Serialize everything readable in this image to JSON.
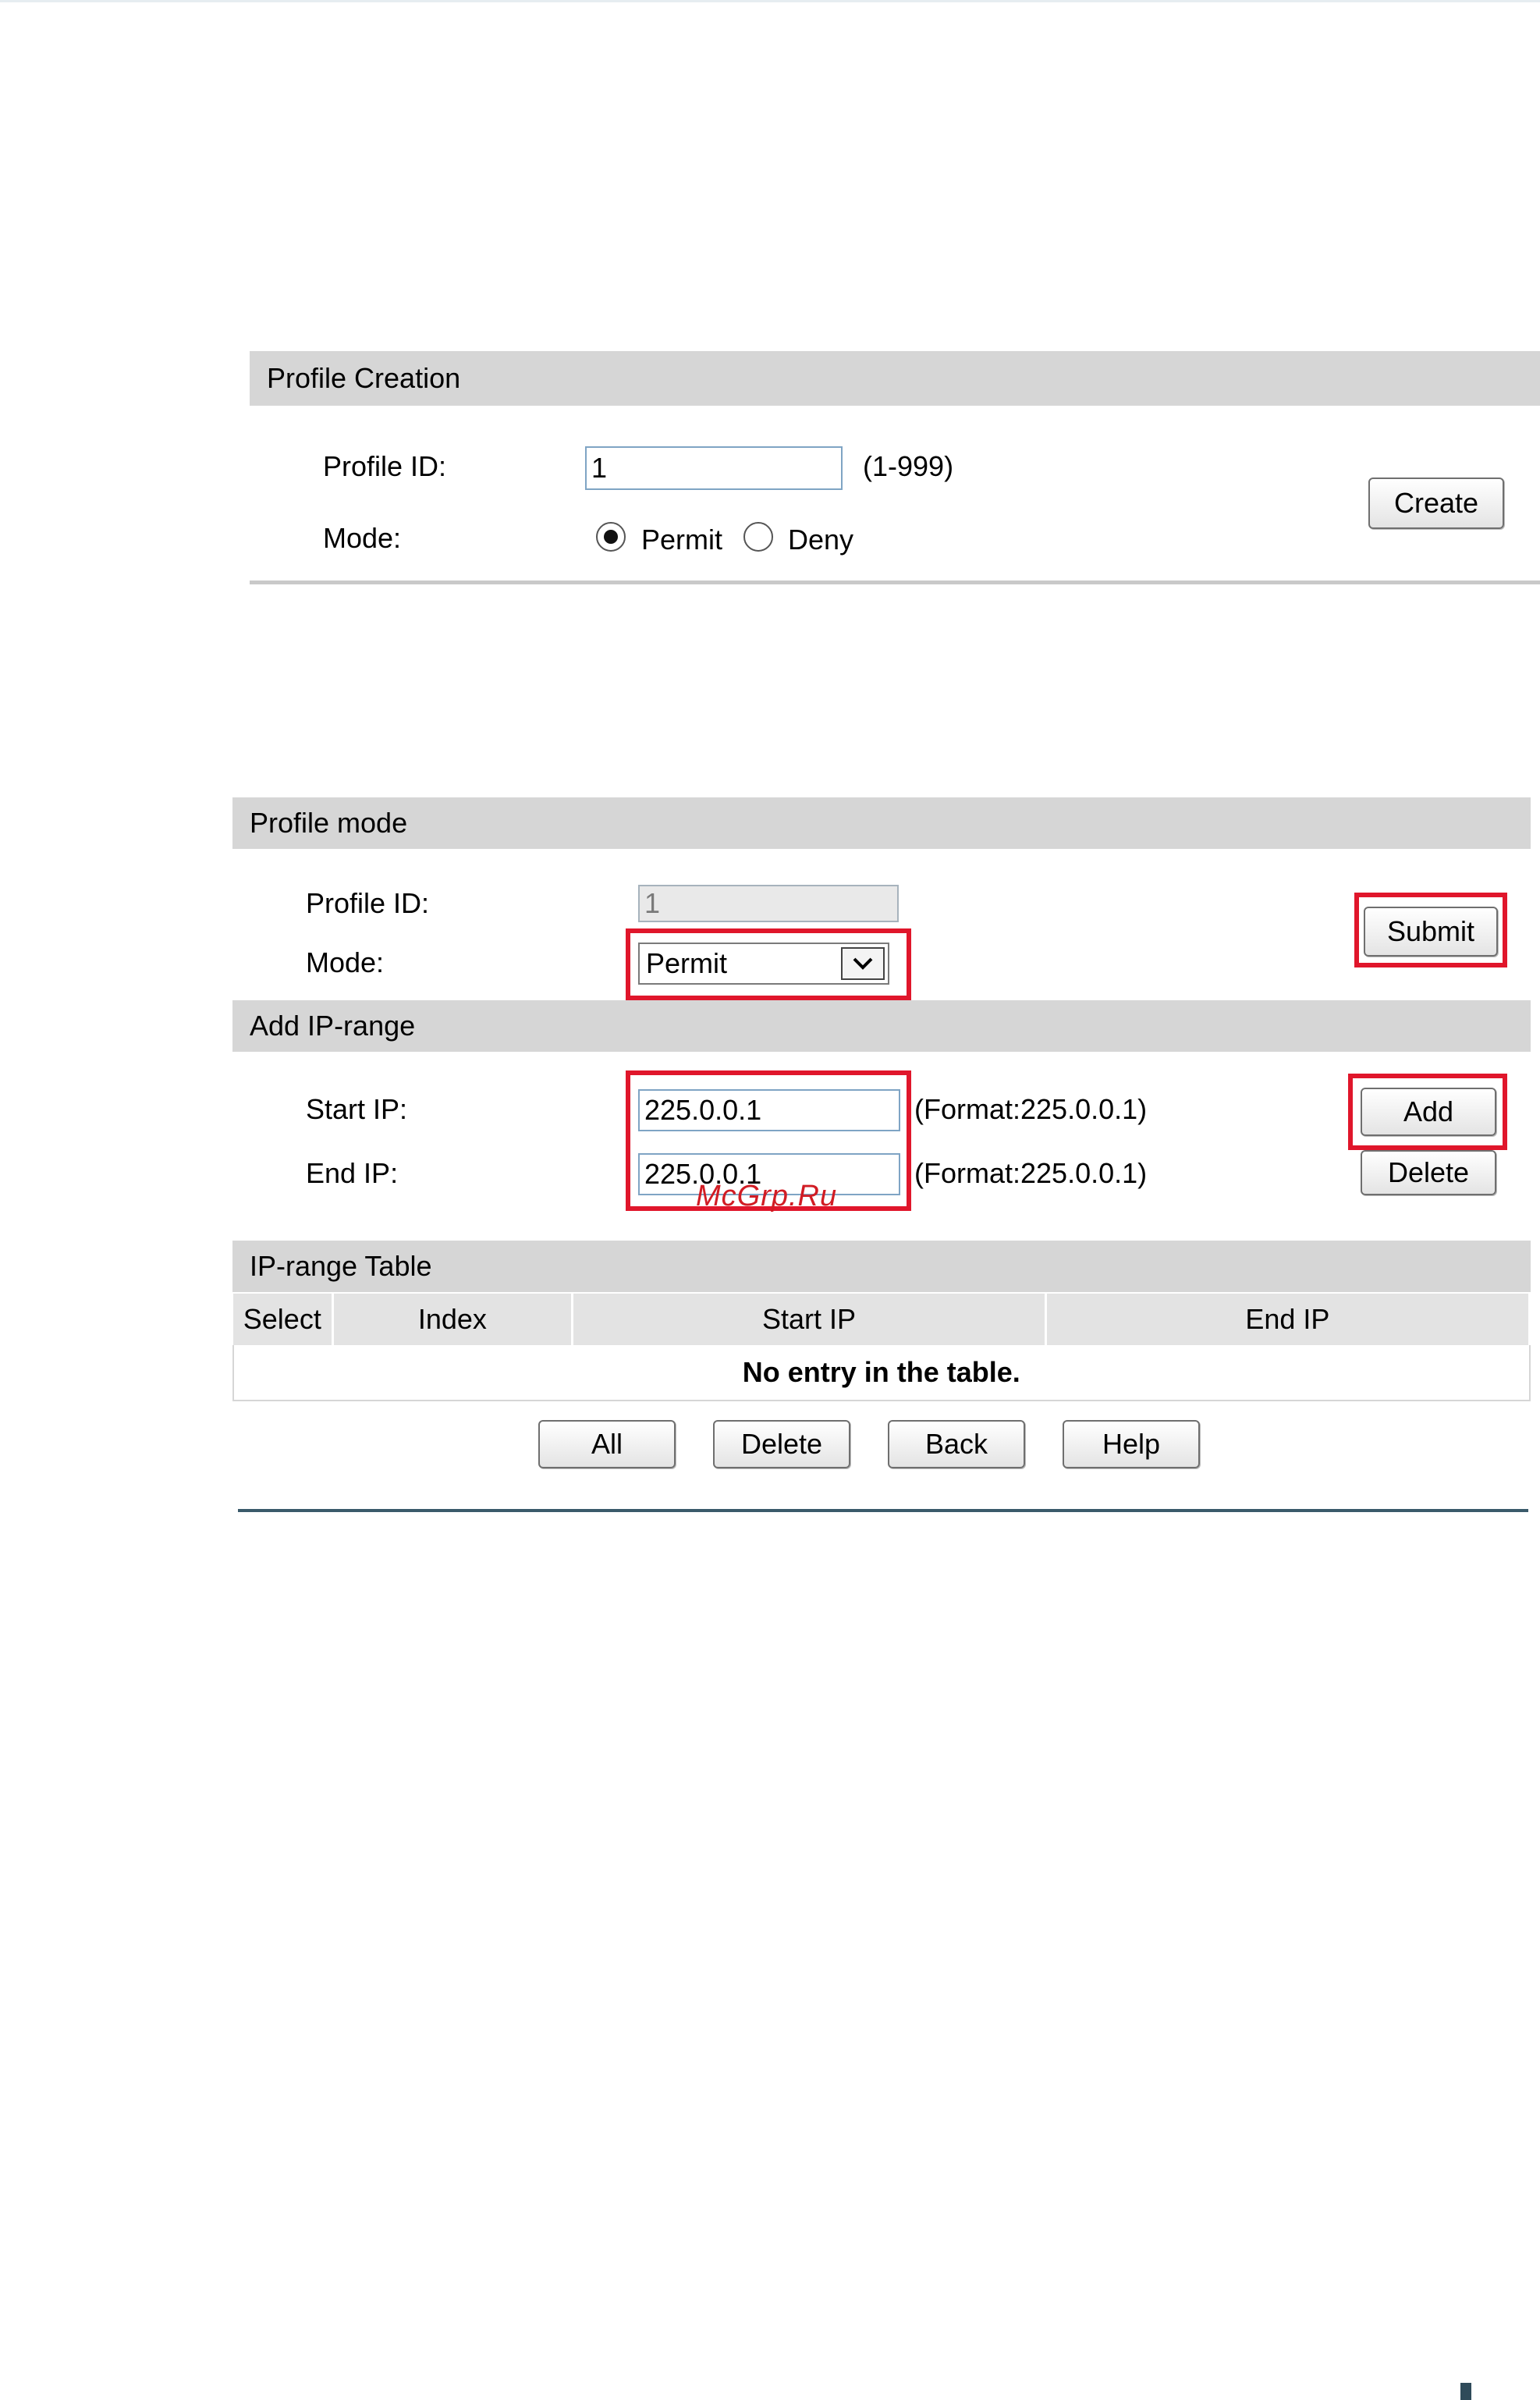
{
  "profile_creation": {
    "title": "Profile Creation",
    "profile_id_label": "Profile ID:",
    "profile_id_value": "1",
    "profile_id_range": "(1-999)",
    "mode_label": "Mode:",
    "mode_options": [
      "Permit",
      "Deny"
    ],
    "mode_selected": "Permit",
    "create_label": "Create"
  },
  "profile_mode": {
    "title": "Profile mode",
    "profile_id_label": "Profile ID:",
    "profile_id_value": "1",
    "mode_label": "Mode:",
    "mode_value": "Permit",
    "submit_label": "Submit"
  },
  "add_ip_range": {
    "title": "Add IP-range",
    "start_ip_label": "Start IP:",
    "start_ip_value": "225.0.0.1",
    "start_ip_hint": "(Format:225.0.0.1)",
    "end_ip_label": "End IP:",
    "end_ip_value": "225.0.0.1",
    "end_ip_hint": "(Format:225.0.0.1)",
    "add_label": "Add",
    "delete_label": "Delete"
  },
  "ip_range_table": {
    "title": "IP-range Table",
    "columns": [
      "Select",
      "Index",
      "Start IP",
      "End IP"
    ],
    "empty_message": "No entry in the table.",
    "buttons": [
      "All",
      "Delete",
      "Back",
      "Help"
    ]
  },
  "watermark": "McGrp.Ru",
  "colors": {
    "highlight": "#e0162b",
    "header_bar": "#d6d6d6"
  }
}
